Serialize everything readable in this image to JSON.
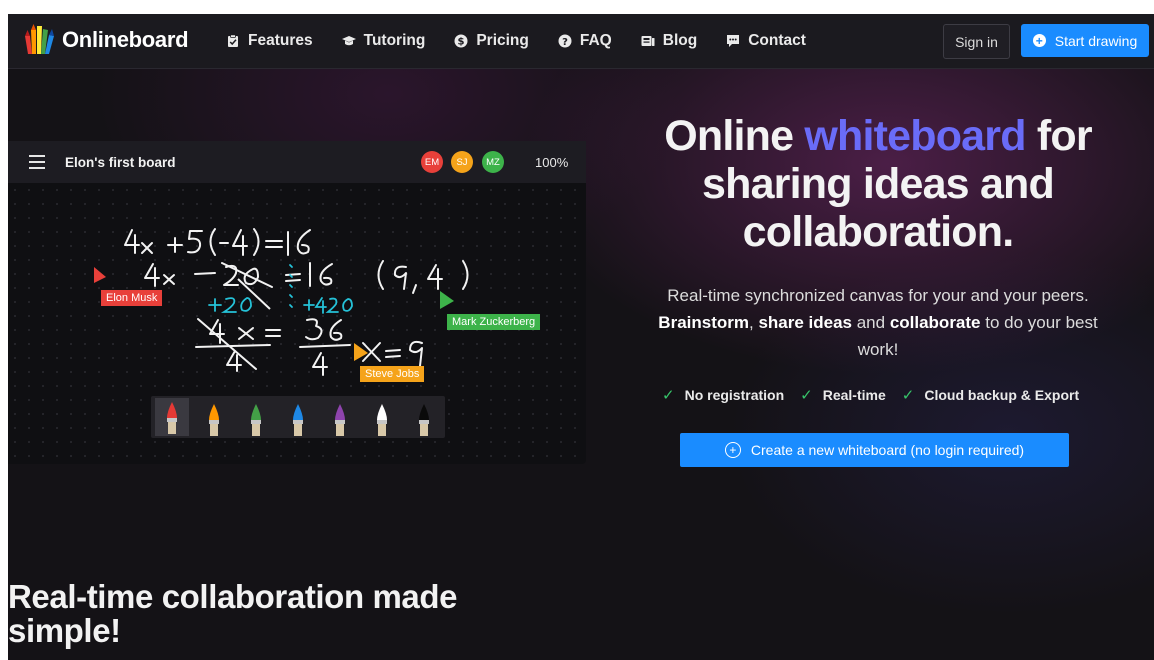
{
  "nav": {
    "brand": "Onlineboard",
    "links": [
      {
        "label": "Features",
        "icon": "clipboard-check-icon"
      },
      {
        "label": "Tutoring",
        "icon": "graduation-cap-icon"
      },
      {
        "label": "Pricing",
        "icon": "dollar-circle-icon"
      },
      {
        "label": "FAQ",
        "icon": "question-circle-icon"
      },
      {
        "label": "Blog",
        "icon": "blog-icon"
      },
      {
        "label": "Contact",
        "icon": "comment-icon"
      }
    ],
    "signin_label": "Sign in",
    "start_label": "Start drawing"
  },
  "board": {
    "title": "Elon's first board",
    "avatars": [
      {
        "initials": "EM",
        "color": "#e8403a"
      },
      {
        "initials": "SJ",
        "color": "#f5a31a"
      },
      {
        "initials": "MZ",
        "color": "#3db34a"
      }
    ],
    "zoom": "100%",
    "cursors": [
      {
        "name": "Elon Musk",
        "color": "#e8403a"
      },
      {
        "name": "Mark Zuckerberg",
        "color": "#3db34a"
      },
      {
        "name": "Steve Jobs",
        "color": "#f5a31a"
      }
    ],
    "pen_colors": [
      "#e53935",
      "#ff9800",
      "#43a047",
      "#1e88e5",
      "#8e44ad",
      "#ffffff",
      "#111111"
    ]
  },
  "hero": {
    "title_pre": "Online ",
    "title_accent": "whiteboard",
    "title_post": " for sharing ideas and collaboration.",
    "subtitle_1": "Real-time synchronized canvas for your and your peers. ",
    "subtitle_b1": "Brainstorm",
    "subtitle_2": ", ",
    "subtitle_b2": "share ideas",
    "subtitle_3": " and ",
    "subtitle_b3": "collaborate",
    "subtitle_4": " to do your best work!",
    "features": [
      "No registration",
      "Real-time",
      "Cloud backup & Export"
    ],
    "cta_label": "Create a new whiteboard (no login required)"
  },
  "section": {
    "title": "Real-time collaboration made simple!"
  },
  "colors": {
    "accent": "#6a6cf8",
    "primary_button": "#1a8cff",
    "check": "#37c46a"
  }
}
